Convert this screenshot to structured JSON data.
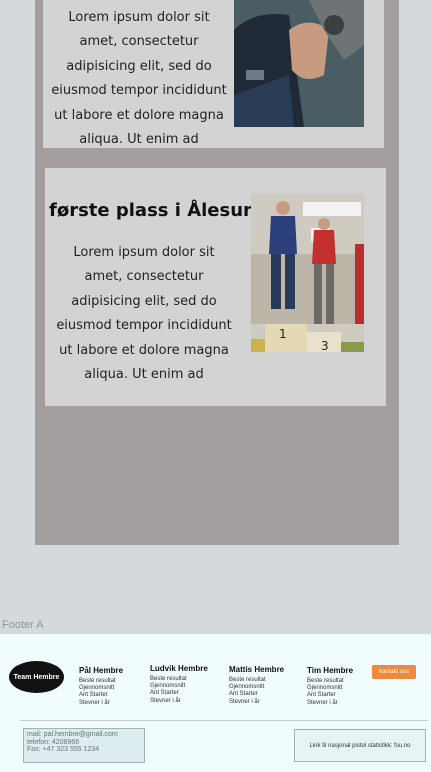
{
  "cards": [
    {
      "title": "",
      "text": "Lorem ipsum dolor sit amet, consectetur adipisicing elit, sed do eiusmod tempor incididunt ut labore et dolore magna aliqua. Ut enim ad"
    },
    {
      "title": "første plass i Ålesund",
      "text": "Lorem ipsum dolor sit amet, consectetur adipisicing elit, sed do eiusmod tempor incididunt ut labore et dolore magna aliqua. Ut enim ad"
    }
  ],
  "footer": {
    "label": "Footer A",
    "logo_text": "Team Hembre",
    "members": [
      {
        "name": "Pål Hembre",
        "stats": [
          "Beste resultat",
          "Gjennomsnitt",
          "Ant Starter",
          "Stevner i år"
        ]
      },
      {
        "name": "Ludvik Hembre",
        "stats": [
          "Beste resultat",
          "Gjennomsnitt",
          "Ant Starter",
          "Stevner i år"
        ]
      },
      {
        "name": "Mattis Hembre",
        "stats": [
          "Beste resultat",
          "Gjennomsnitt",
          "Ant Starter",
          "Stevner i år"
        ]
      },
      {
        "name": "Tim Hembre",
        "stats": [
          "Beste resultat",
          "Gjennomsnitt",
          "Ant Starter",
          "Stevner i år"
        ]
      }
    ],
    "contact_button": "kontakt oss",
    "contact": {
      "mail": "mail: pal.hembre@gmail.com",
      "phone": "telefon: 4206966",
      "fax": "Fax: +47 323 555 1234"
    },
    "link_text": "Link til nasjonal pistol statistikk: fsu.no"
  },
  "colors": {
    "background": "#d3d9dc",
    "panel": "#a39d9e",
    "card": "#d3d3d3",
    "footer": "#f1fcfd",
    "accent_button": "#ec8a3d"
  }
}
